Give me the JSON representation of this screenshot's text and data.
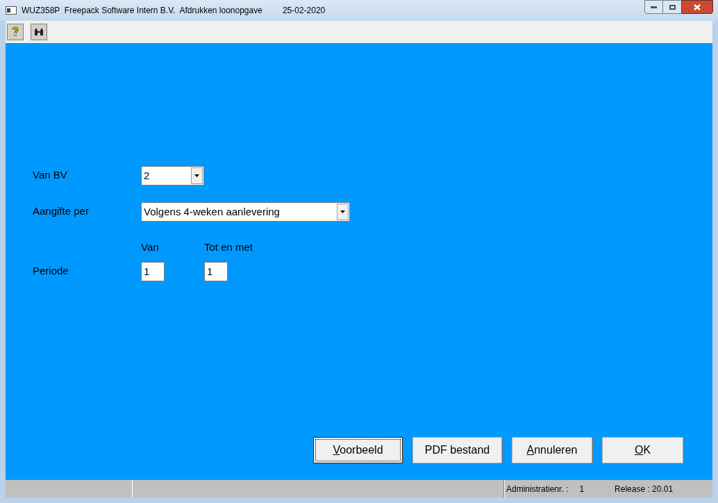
{
  "window": {
    "title": "WUZ358P  Freepack Software Intern B.V.  Afdrukken loonopgave",
    "date": "25-02-2020"
  },
  "form": {
    "van_bv": {
      "label": "Van BV",
      "value": "2"
    },
    "aangifte_per": {
      "label": "Aangifte per",
      "value": "Volgens 4-weken aanlevering"
    },
    "periode": {
      "label": "Periode",
      "from_header": "Van",
      "to_header": "Tot en met",
      "from": "1",
      "to": "1"
    }
  },
  "buttons": [
    {
      "label": "Voorbeeld",
      "underline_first": true,
      "focused": true
    },
    {
      "label": "PDF bestand",
      "underline_first": false,
      "focused": false
    },
    {
      "label": "Annuleren",
      "underline_first": true,
      "focused": false
    },
    {
      "label": "OK",
      "underline_first": true,
      "focused": false
    }
  ],
  "status_bar": {
    "admin_label": "Administratienr. :",
    "admin_value": "1",
    "release": "Release : 20.01"
  }
}
